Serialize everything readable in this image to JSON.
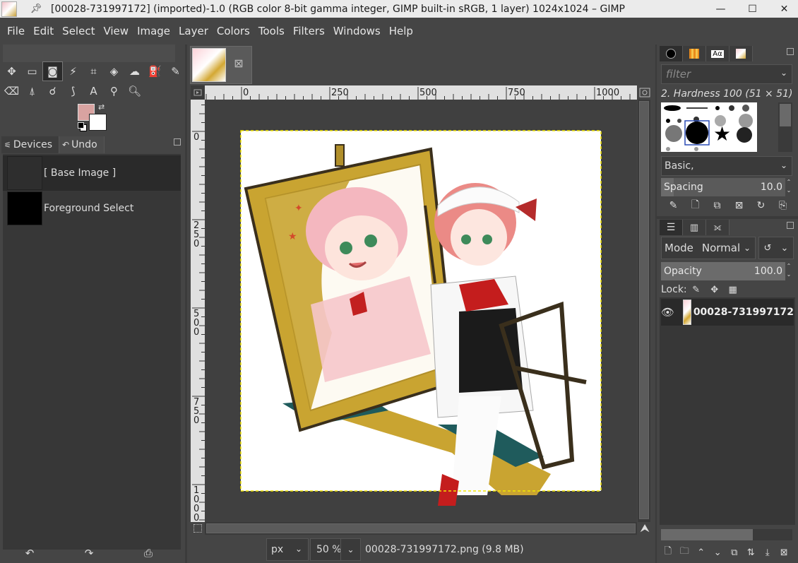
{
  "window": {
    "title": "[00028-731997172] (imported)-1.0 (RGB color 8-bit gamma integer, GIMP built-in sRGB, 1 layer) 1024x1024 – GIMP",
    "pin_icon": "pin-icon",
    "controls": [
      "minimize-icon",
      "maximize-icon",
      "close-icon"
    ]
  },
  "menu": [
    "File",
    "Edit",
    "Select",
    "View",
    "Image",
    "Layer",
    "Colors",
    "Tools",
    "Filters",
    "Windows",
    "Help"
  ],
  "toolbox": {
    "row1": [
      {
        "name": "move-tool-icon",
        "glyph": "✥"
      },
      {
        "name": "rect-select-tool-icon",
        "glyph": "▭"
      },
      {
        "name": "foreground-select-tool-icon",
        "glyph": "◙",
        "active": true
      },
      {
        "name": "fuzzy-select-tool-icon",
        "glyph": "⚡"
      },
      {
        "name": "crop-tool-icon",
        "glyph": "⌗"
      },
      {
        "name": "unified-transform-tool-icon",
        "glyph": "◈"
      },
      {
        "name": "warp-transform-tool-icon",
        "glyph": "☁"
      },
      {
        "name": "bucket-fill-tool-icon",
        "glyph": "⛽"
      },
      {
        "name": "paintbrush-tool-icon",
        "glyph": "✎"
      }
    ],
    "row2": [
      {
        "name": "eraser-tool-icon",
        "glyph": "⌫"
      },
      {
        "name": "clone-tool-icon",
        "glyph": "⍋"
      },
      {
        "name": "smudge-tool-icon",
        "glyph": "☌"
      },
      {
        "name": "paths-tool-icon",
        "glyph": "⟆"
      },
      {
        "name": "text-tool-icon",
        "glyph": "A"
      },
      {
        "name": "color-picker-tool-icon",
        "glyph": "⚲"
      },
      {
        "name": "zoom-tool-icon",
        "glyph": "🔍︎"
      }
    ],
    "fg_color": "#d9a3a1",
    "bg_color": "#ffffff"
  },
  "left_panel": {
    "tabs": [
      "Devices",
      "Undo"
    ],
    "active_tab": "Undo",
    "undo_items": [
      {
        "label": "[ Base Image ]",
        "selected": true
      },
      {
        "label": "Foreground Select",
        "selected": false
      }
    ],
    "footer": [
      {
        "name": "undo-icon",
        "glyph": "↶"
      },
      {
        "name": "redo-icon",
        "glyph": "↷"
      },
      {
        "name": "clear-history-icon",
        "glyph": "⎙"
      }
    ]
  },
  "image_window": {
    "tab_close": "⊠",
    "ruler_h_labels": [
      "0",
      "250",
      "500",
      "750",
      "1000"
    ],
    "ruler_v_labels": [
      "0",
      "250",
      "500",
      "750",
      "1000"
    ],
    "unit": "px",
    "zoom": "50 %",
    "status": "00028-731997172.png (9.8 MB)"
  },
  "brushes": {
    "filter_placeholder": "filter",
    "brush_name": "2. Hardness 100 (51 × 51)",
    "tag": "Basic,",
    "spacing_label": "Spacing",
    "spacing_value": "10.0",
    "spacing_fraction": 0.1,
    "actions": [
      {
        "name": "edit-brush-icon",
        "glyph": "✎"
      },
      {
        "name": "new-brush-icon",
        "glyph": "🗋︎"
      },
      {
        "name": "duplicate-brush-icon",
        "glyph": "⧉"
      },
      {
        "name": "delete-brush-icon",
        "glyph": "⊠"
      },
      {
        "name": "refresh-brushes-icon",
        "glyph": "↻"
      },
      {
        "name": "open-brush-as-image-icon",
        "glyph": "⎘"
      }
    ]
  },
  "layers": {
    "mode_label": "Mode",
    "mode_value": "Normal",
    "opacity_label": "Opacity",
    "opacity_value": "100.0",
    "opacity_fraction": 1.0,
    "lock_label": "Lock:",
    "lock_icons": [
      {
        "name": "lock-pixels-icon",
        "glyph": "✎"
      },
      {
        "name": "lock-position-icon",
        "glyph": "✥"
      },
      {
        "name": "lock-alpha-icon",
        "glyph": "▦"
      }
    ],
    "items": [
      {
        "name": "00028-731997172",
        "visible": true
      }
    ],
    "footer": [
      {
        "name": "new-layer-icon",
        "glyph": "🗋︎"
      },
      {
        "name": "new-layer-group-icon",
        "glyph": "🗀︎"
      },
      {
        "name": "raise-layer-icon",
        "glyph": "⌃"
      },
      {
        "name": "lower-layer-icon",
        "glyph": "⌄"
      },
      {
        "name": "duplicate-layer-icon",
        "glyph": "⧉"
      },
      {
        "name": "anchor-layer-icon",
        "glyph": "⇅"
      },
      {
        "name": "merge-layer-icon",
        "glyph": "⤓"
      },
      {
        "name": "delete-layer-icon",
        "glyph": "⊠"
      }
    ]
  }
}
